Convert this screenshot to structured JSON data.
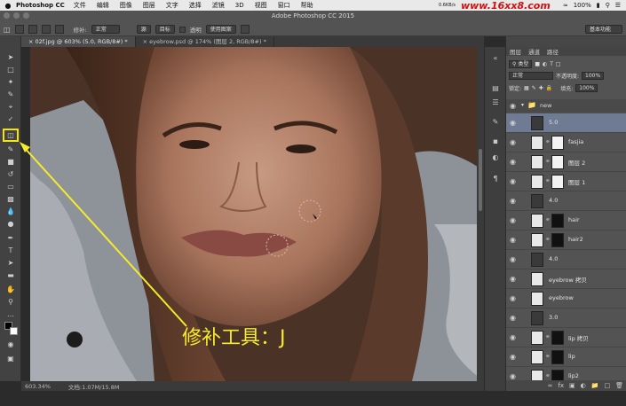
{
  "menubar": {
    "apple": "",
    "app_name": "Photoshop CC",
    "menus": [
      "文件",
      "编辑",
      "图像",
      "图层",
      "文字",
      "选择",
      "滤镜",
      "3D",
      "视图",
      "窗口",
      "帮助"
    ],
    "watermark": "www.16xx8.com",
    "net_up": "0.6KB/s",
    "net_down": "0.6KB/s",
    "battery": "100%"
  },
  "window": {
    "title": "Adobe Photoshop CC 2015"
  },
  "options_bar": {
    "patch_label": "修补:",
    "patch_mode": "正常",
    "source_label": "源",
    "target_label": "目标",
    "transparent_label": "透明",
    "use_pattern_label": "使用图案",
    "workspace": "基本功能"
  },
  "tabs": [
    {
      "label": "02f.jpg @ 603% (5.0, RGB/8#) *",
      "active": true
    },
    {
      "label": "eyebrow.psd @ 174% (图层 2, RGB/8#) *",
      "active": false
    }
  ],
  "status": {
    "zoom": "603.34%",
    "doc": "文档:1.07M/15.8M"
  },
  "annotation": {
    "text": "修补工具：J",
    "color": "#f5ec2a"
  },
  "layers_panel": {
    "tabs": [
      "图层",
      "通道",
      "路径"
    ],
    "kind_label": "类型",
    "blend_mode": "正常",
    "opacity_label": "不透明度:",
    "opacity_value": "100%",
    "lock_label": "锁定:",
    "fill_label": "填充:",
    "fill_value": "100%",
    "group_name": "new",
    "layers": [
      {
        "name": "5.0",
        "thumb": "photo",
        "mask": false,
        "selected": true
      },
      {
        "name": "fasjia",
        "thumb": "white",
        "mask": "white",
        "selected": false
      },
      {
        "name": "图层 2",
        "thumb": "white",
        "mask": "white",
        "selected": false
      },
      {
        "name": "图层 1",
        "thumb": "white",
        "mask": "white",
        "selected": false
      },
      {
        "name": "4.0",
        "thumb": "photo",
        "mask": false,
        "selected": false
      },
      {
        "name": "hair",
        "thumb": "white",
        "mask": "black",
        "selected": false
      },
      {
        "name": "hair2",
        "thumb": "white",
        "mask": "black",
        "selected": false
      },
      {
        "name": "4.0",
        "thumb": "photo",
        "mask": false,
        "selected": false
      },
      {
        "name": "eyebrow 拷贝",
        "thumb": "white",
        "mask": false,
        "selected": false
      },
      {
        "name": "eyebrow",
        "thumb": "white",
        "mask": false,
        "selected": false
      },
      {
        "name": "3.0",
        "thumb": "photo",
        "mask": false,
        "selected": false
      },
      {
        "name": "lip 拷贝",
        "thumb": "white",
        "mask": "black",
        "selected": false
      },
      {
        "name": "lip",
        "thumb": "white",
        "mask": "black",
        "selected": false
      },
      {
        "name": "lip2",
        "thumb": "white",
        "mask": "black",
        "selected": false
      }
    ]
  }
}
